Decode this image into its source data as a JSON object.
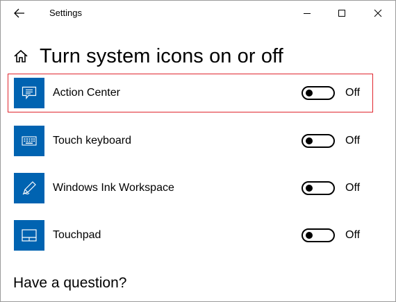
{
  "window": {
    "title": "Settings"
  },
  "header": {
    "title": "Turn system icons on or off"
  },
  "items": [
    {
      "label": "Action Center",
      "state": "Off",
      "icon": "action-center-icon",
      "selected": true
    },
    {
      "label": "Touch keyboard",
      "state": "Off",
      "icon": "keyboard-icon",
      "selected": false
    },
    {
      "label": "Windows Ink Workspace",
      "state": "Off",
      "icon": "pen-icon",
      "selected": false
    },
    {
      "label": "Touchpad",
      "state": "Off",
      "icon": "touchpad-icon",
      "selected": false
    }
  ],
  "footer": {
    "question": "Have a question?"
  },
  "colors": {
    "accent": "#0063b1",
    "selection_border": "#e0262e"
  }
}
